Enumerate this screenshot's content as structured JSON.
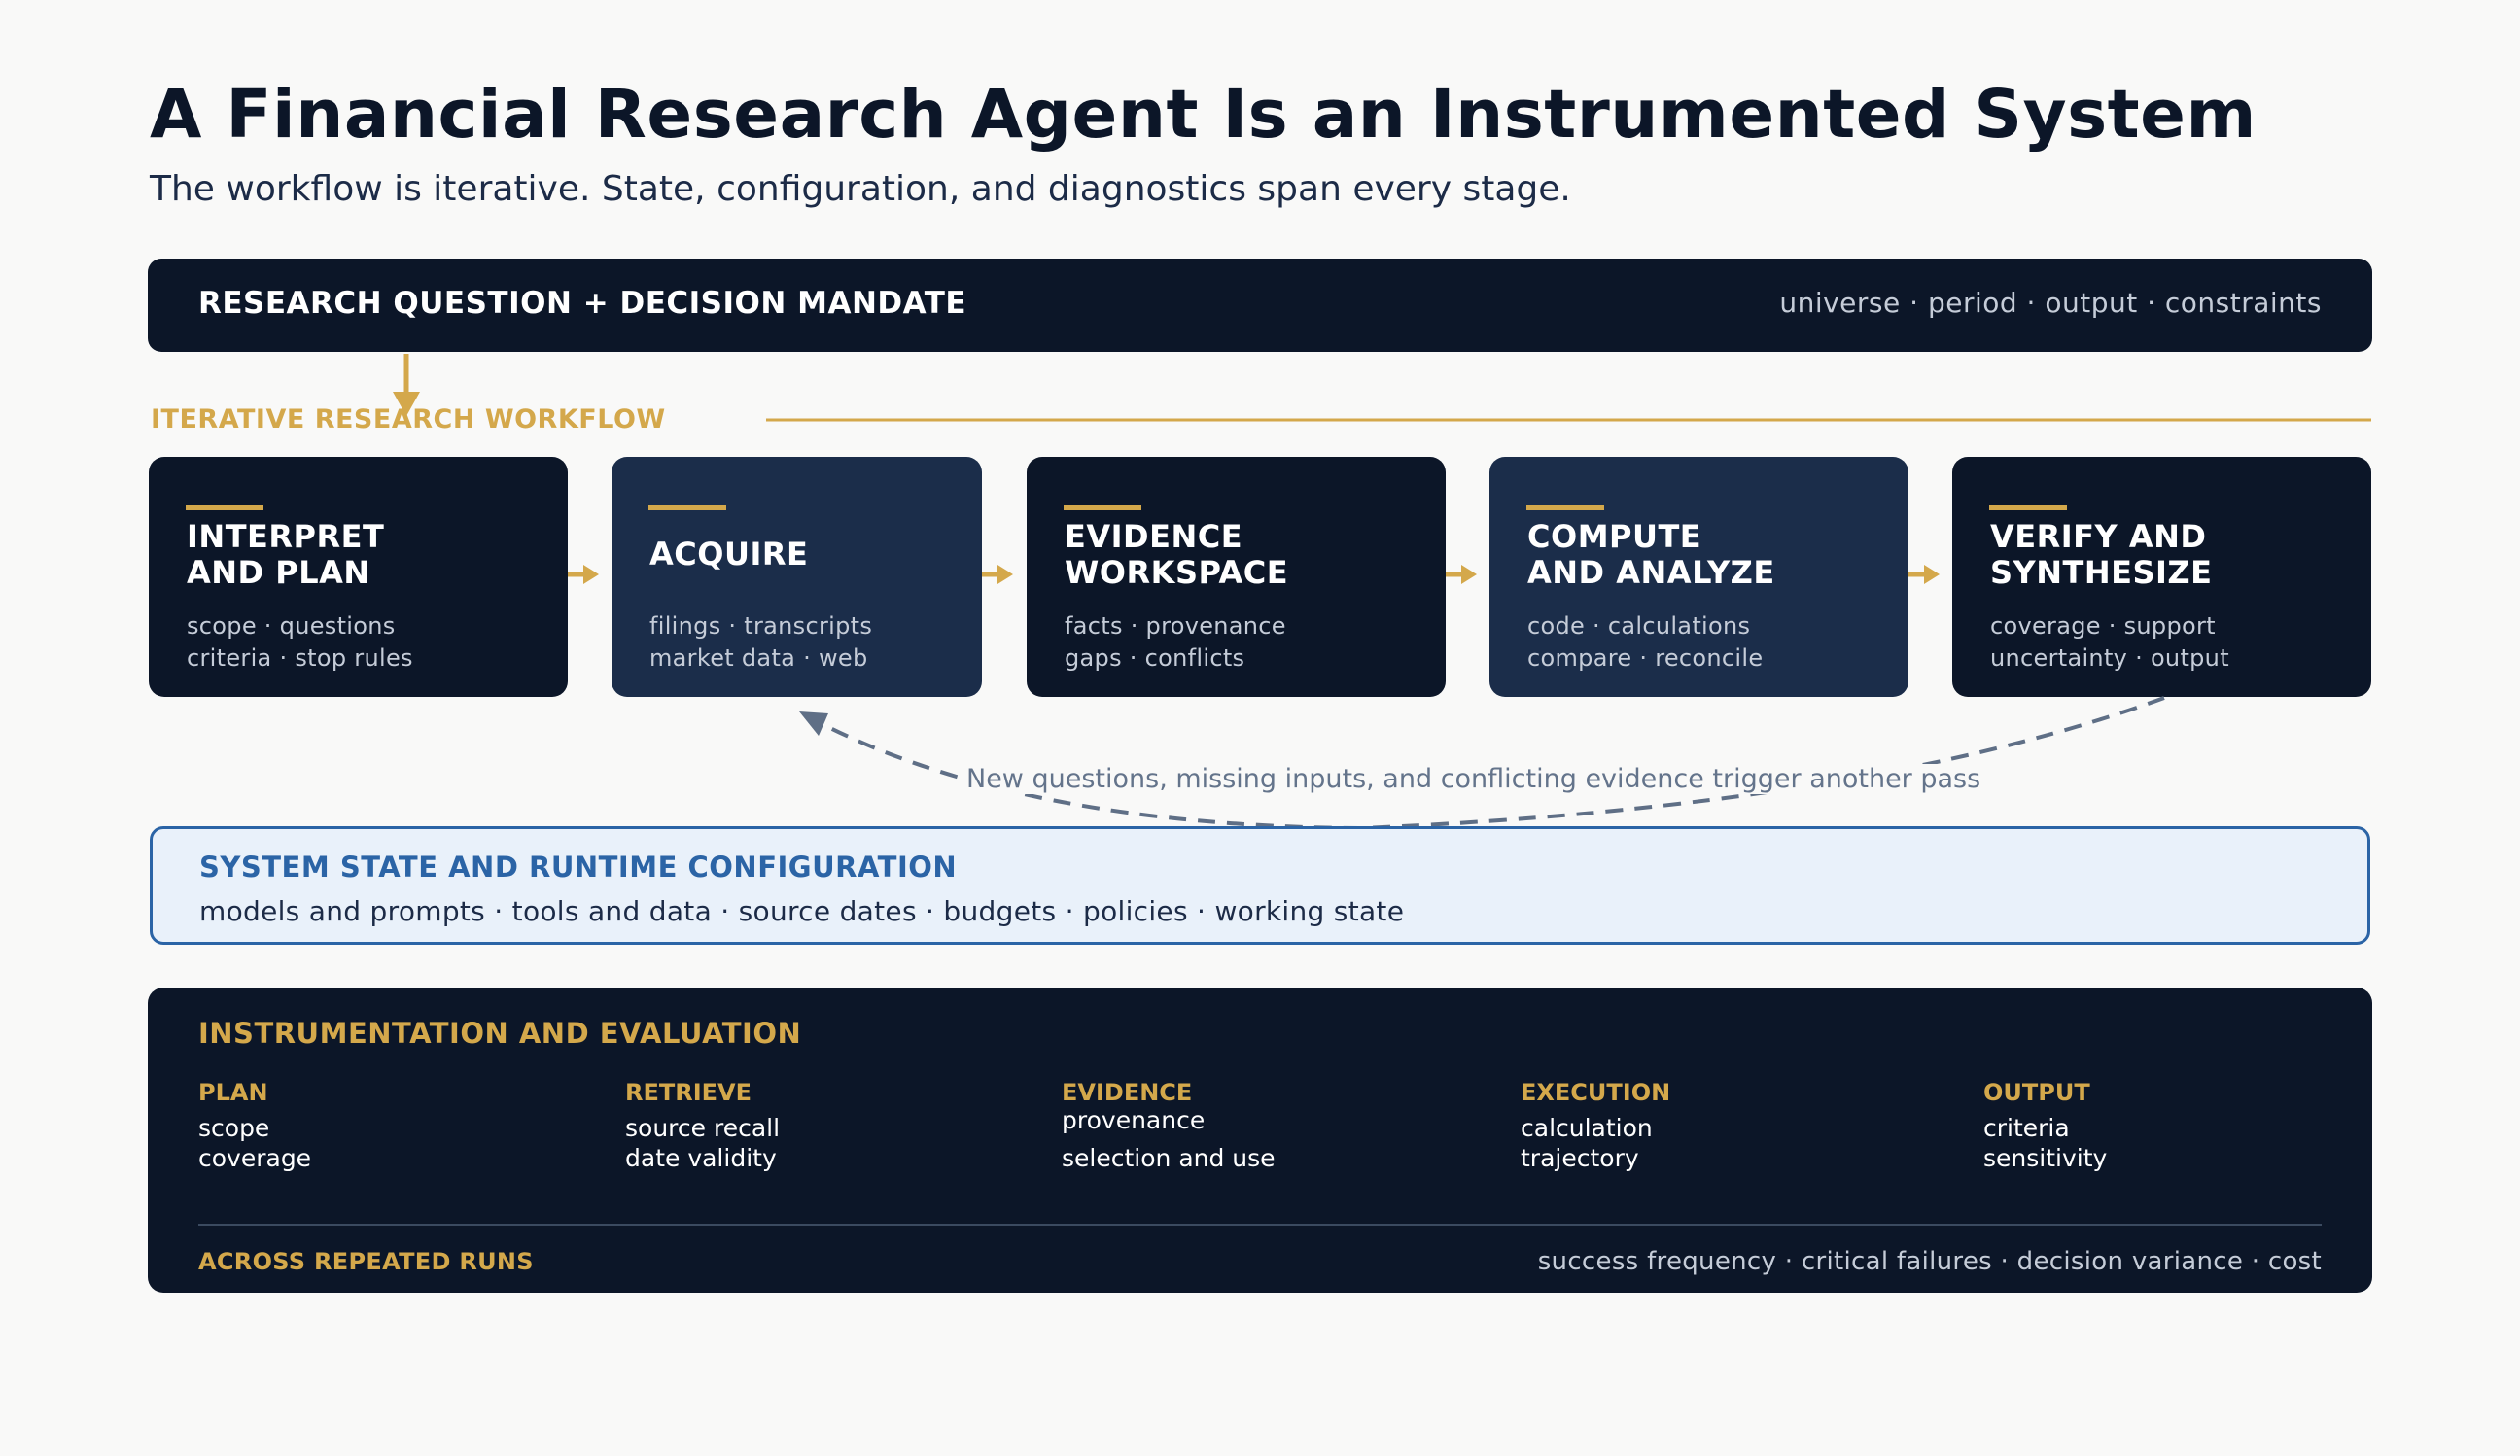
{
  "title": "A Financial Research Agent Is an Instrumented System",
  "subtitle": "The workflow is iterative. State, configuration, and diagnostics span every stage.",
  "mandate": {
    "label": "RESEARCH QUESTION + DECISION MANDATE",
    "items": "universe  ·  period  ·  output  ·  constraints"
  },
  "workflow": {
    "label": "ITERATIVE RESEARCH WORKFLOW",
    "stages": [
      {
        "title": "INTERPRET\nAND PLAN",
        "items": "scope  ·  questions\ncriteria  ·  stop rules"
      },
      {
        "title": "ACQUIRE",
        "items": "filings  ·  transcripts\nmarket data  ·  web"
      },
      {
        "title": "EVIDENCE\nWORKSPACE",
        "items": "facts  ·  provenance\ngaps  ·  conflicts"
      },
      {
        "title": "COMPUTE\nAND ANALYZE",
        "items": "code  ·  calculations\ncompare  ·  reconcile"
      },
      {
        "title": "VERIFY AND\nSYNTHESIZE",
        "items": "coverage  ·  support\nuncertainty  ·  output"
      }
    ],
    "loop_text": "New questions, missing inputs, and conflicting evidence trigger another pass"
  },
  "state": {
    "title": "SYSTEM STATE AND RUNTIME CONFIGURATION",
    "items": "models and prompts  ·  tools and data  ·  source dates  ·  budgets  ·  policies  ·  working state"
  },
  "instrumentation": {
    "title": "INSTRUMENTATION AND EVALUATION",
    "columns": [
      {
        "head": "PLAN",
        "l1": "scope",
        "l2": "coverage"
      },
      {
        "head": "RETRIEVE",
        "l1": "source recall",
        "l2": "date validity"
      },
      {
        "head": "EVIDENCE",
        "l1": "provenance",
        "l2": "selection and use"
      },
      {
        "head": "EXECUTION",
        "l1": "calculation",
        "l2": "trajectory"
      },
      {
        "head": "OUTPUT",
        "l1": "criteria",
        "l2": "sensitivity"
      }
    ],
    "runs_label": "ACROSS REPEATED RUNS",
    "runs_items": "success frequency  ·  critical failures  ·  decision variance  ·  cost"
  },
  "colors": {
    "navy": "#0c1628",
    "stage_blue": "#1b2d4a",
    "gold": "#d4a84b",
    "state_blue": "#2b64a6",
    "state_bg": "#e9f1fa",
    "loop_gray": "#5f6f86"
  }
}
